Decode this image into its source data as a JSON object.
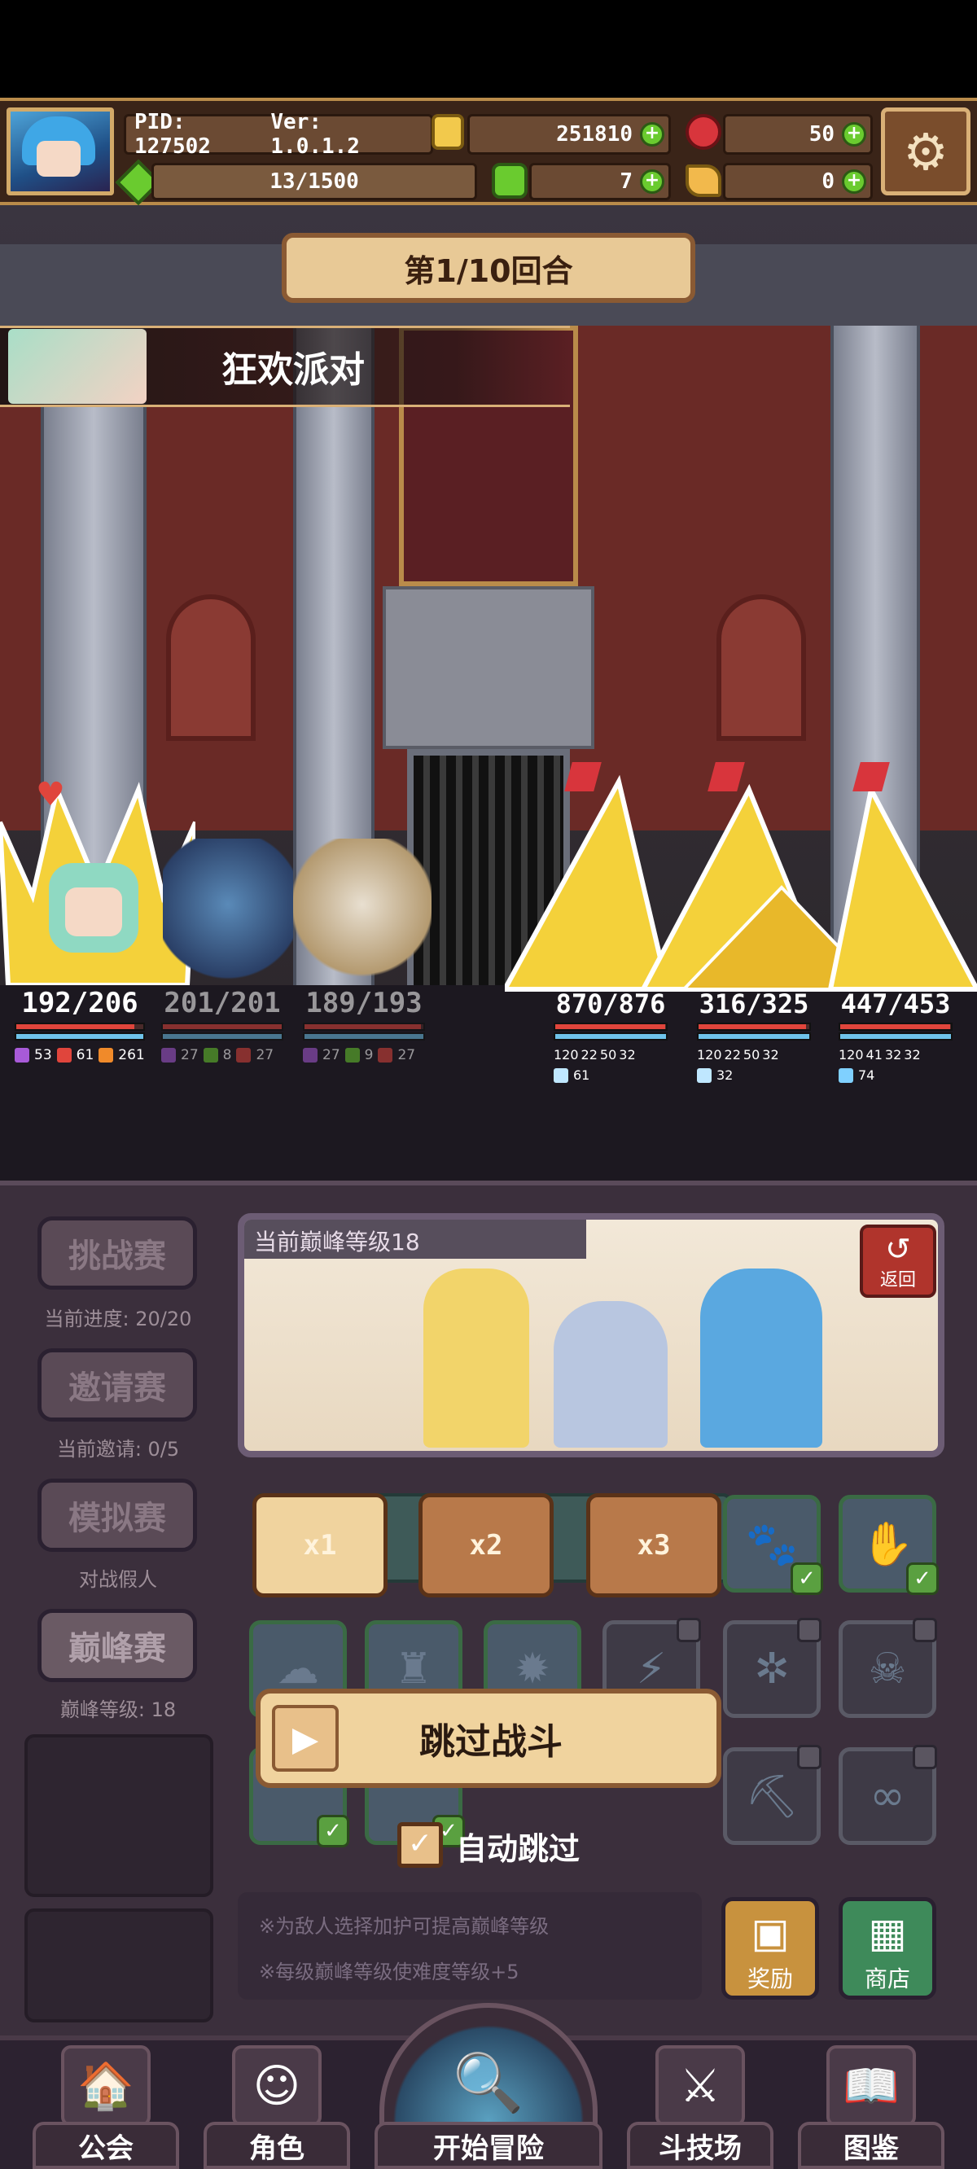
{
  "header": {
    "pid": "PID: 127502",
    "version": "Ver: 1.0.1.2",
    "gold": "251810",
    "ruby": "50",
    "stamina": "13/1500",
    "clover": "7",
    "key_items": "0"
  },
  "battle": {
    "round": "第1/10回合",
    "event_name": "狂欢派对",
    "allies": [
      {
        "hp": "192/206",
        "hp_fraction": 0.93,
        "stats": [
          "53",
          "61",
          "261"
        ]
      },
      {
        "hp": "201/201",
        "hp_fraction": 1.0,
        "stats": [
          "27",
          "8",
          "27"
        ]
      },
      {
        "hp": "189/193",
        "hp_fraction": 0.98,
        "stats": [
          "27",
          "9",
          "27"
        ]
      }
    ],
    "enemies": [
      {
        "hp": "870/876",
        "hp_fraction": 0.99,
        "stats": [
          "120",
          "22",
          "50",
          "32"
        ],
        "extra": "61"
      },
      {
        "hp": "316/325",
        "hp_fraction": 0.97,
        "stats": [
          "120",
          "22",
          "50",
          "32"
        ],
        "extra": "32"
      },
      {
        "hp": "447/453",
        "hp_fraction": 0.99,
        "stats": [
          "120",
          "41",
          "32",
          "32"
        ],
        "extra": "74"
      }
    ]
  },
  "sidebar": {
    "challenge": {
      "label": "挑战赛",
      "sub": "当前进度: 20/20"
    },
    "invite": {
      "label": "邀请赛",
      "sub": "当前邀请: 0/5"
    },
    "simulate": {
      "label": "模拟赛",
      "sub": "对战假人"
    },
    "peak": {
      "label": "巅峰赛",
      "sub": "巅峰等级: 18"
    }
  },
  "preview": {
    "caption": "当前巅峰等级18",
    "back_label": "返回"
  },
  "speeds": [
    "x1",
    "x2",
    "x3"
  ],
  "skip": {
    "label": "跳过战斗",
    "auto_label": "自动跳过"
  },
  "notes": [
    "※为敌人选择加护可提高巅峰等级",
    "※每级巅峰等级使难度等级+5"
  ],
  "shop": {
    "reward_label": "奖励",
    "store_label": "商店"
  },
  "nav": {
    "guild": "公会",
    "role": "角色",
    "adventure": "开始冒险",
    "arena": "斗技场",
    "codex": "图鉴"
  },
  "colors": {
    "hp_red": "#e0453c",
    "mana_blue": "#6fc3ea",
    "gold": "#f2c94c",
    "accent_green": "#6acb2f",
    "parchment": "#f0d39e"
  }
}
